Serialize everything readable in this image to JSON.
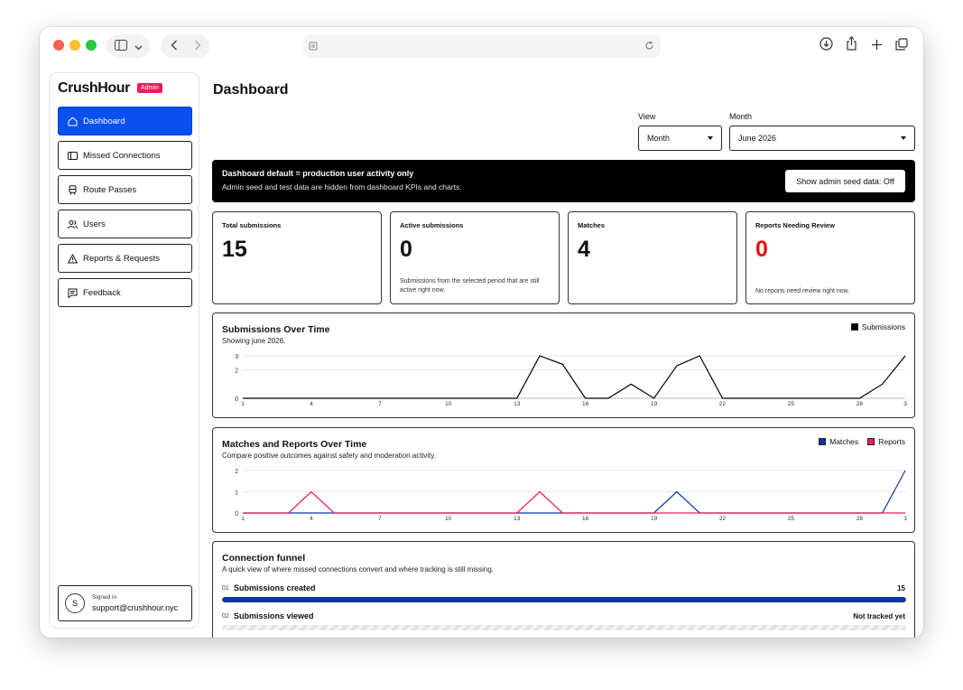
{
  "app": {
    "brand": "CrushHour",
    "badge": "Admin"
  },
  "sidebar": {
    "items": [
      {
        "label": "Dashboard",
        "icon": "home-icon",
        "active": true
      },
      {
        "label": "Missed Connections",
        "icon": "panel-icon"
      },
      {
        "label": "Route Passes",
        "icon": "train-icon"
      },
      {
        "label": "Users",
        "icon": "users-icon"
      },
      {
        "label": "Reports & Requests",
        "icon": "warning-icon"
      },
      {
        "label": "Feedback",
        "icon": "message-icon"
      }
    ],
    "signed_in": {
      "label": "Signed in",
      "email": "support@crushhour.nyc",
      "avatar": "S"
    }
  },
  "page": {
    "title": "Dashboard"
  },
  "controls": {
    "view_label": "View",
    "view_value": "Month",
    "month_label": "Month",
    "month_value": "June 2026"
  },
  "banner": {
    "title": "Dashboard default = production user activity only",
    "subtitle": "Admin seed and test data are hidden from dashboard KPIs and charts.",
    "button": "Show admin seed data: Off"
  },
  "kpis": [
    {
      "label": "Total submissions",
      "value": "15",
      "note": ""
    },
    {
      "label": "Active submissions",
      "value": "0",
      "note": "Submissions from the selected period that are still active right now."
    },
    {
      "label": "Matches",
      "value": "4",
      "note": ""
    },
    {
      "label": "Reports Needing Review",
      "value": "0",
      "note": "No reports need review right now."
    }
  ],
  "charts": {
    "submissions": {
      "title": "Submissions Over Time",
      "subtitle": "Showing june 2026."
    },
    "matches": {
      "title": "Matches and Reports Over Time",
      "subtitle": "Compare positive outcomes against safety and moderation activity."
    }
  },
  "chart_data": [
    {
      "type": "line",
      "title": "Submissions Over Time",
      "x": [
        1,
        2,
        3,
        4,
        5,
        6,
        7,
        8,
        9,
        10,
        11,
        12,
        13,
        14,
        15,
        16,
        17,
        18,
        19,
        20,
        21,
        22,
        23,
        24,
        25,
        26,
        27,
        28,
        29,
        30
      ],
      "x_tick_labels": [
        "1",
        "4",
        "7",
        "10",
        "13",
        "16",
        "19",
        "22",
        "25",
        "28",
        "3"
      ],
      "y_tick_labels": [
        "0",
        "2",
        "3"
      ],
      "ylim": [
        0,
        3
      ],
      "grid": true,
      "legend": "top-right",
      "series": [
        {
          "name": "Submissions",
          "color": "#000000",
          "values": [
            0,
            0,
            0,
            0,
            0,
            0,
            0,
            0,
            0,
            0,
            0,
            0,
            0,
            3,
            2.4,
            0,
            0,
            1,
            0,
            2.3,
            3,
            0,
            0,
            0,
            0,
            0,
            0,
            0,
            1,
            3
          ]
        }
      ]
    },
    {
      "type": "line",
      "title": "Matches and Reports Over Time",
      "x": [
        1,
        2,
        3,
        4,
        5,
        6,
        7,
        8,
        9,
        10,
        11,
        12,
        13,
        14,
        15,
        16,
        17,
        18,
        19,
        20,
        21,
        22,
        23,
        24,
        25,
        26,
        27,
        28,
        29,
        30
      ],
      "x_tick_labels": [
        "1",
        "4",
        "7",
        "10",
        "13",
        "16",
        "19",
        "22",
        "25",
        "28",
        "3"
      ],
      "y_tick_labels": [
        "0",
        "1",
        "2"
      ],
      "ylim": [
        0,
        2
      ],
      "grid": true,
      "legend": "top-right",
      "series": [
        {
          "name": "Matches",
          "color": "#0a3a9c",
          "values": [
            0,
            0,
            0,
            0,
            0,
            0,
            0,
            0,
            0,
            0,
            0,
            0,
            0,
            0,
            0,
            0,
            0,
            0,
            0,
            1,
            0,
            0,
            0,
            0,
            0,
            0,
            0,
            0,
            0,
            2
          ]
        },
        {
          "name": "Reports",
          "color": "#ee1c5b",
          "values": [
            0,
            0,
            0,
            1,
            0,
            0,
            0,
            0,
            0,
            0,
            0,
            0,
            0,
            1,
            0,
            0,
            0,
            0,
            0,
            0,
            0,
            0,
            0,
            0,
            0,
            0,
            0,
            0,
            0,
            0
          ]
        }
      ]
    }
  ],
  "funnel": {
    "title": "Connection funnel",
    "subtitle": "A quick view of where missed connections convert and where tracking is still missing.",
    "rows": [
      {
        "num": "01",
        "label": "Submissions created",
        "value": "15",
        "fill": 1.0
      },
      {
        "num": "02",
        "label": "Submissions viewed",
        "value": "Not tracked yet",
        "fill": 0
      }
    ]
  }
}
